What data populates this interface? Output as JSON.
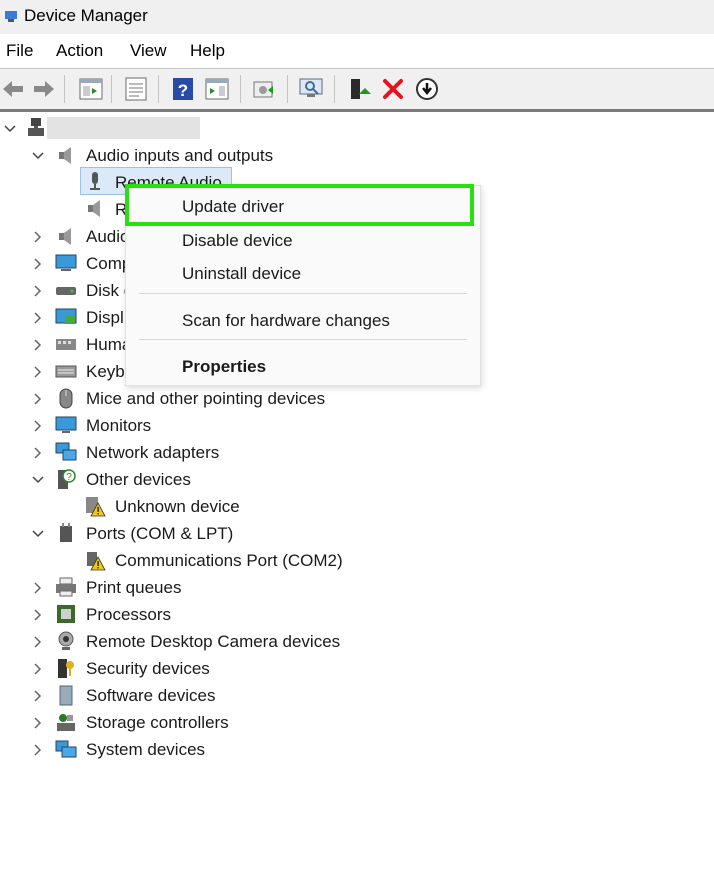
{
  "window": {
    "title": "Device Manager"
  },
  "menubar": {
    "file": "File",
    "action": "Action",
    "view": "View",
    "help": "Help"
  },
  "toolbar": {
    "icons": [
      "back-arrow-icon",
      "forward-arrow-icon",
      "show-hide-tree-icon",
      "properties-icon",
      "help-icon",
      "action-pane-icon",
      "update-driver-icon",
      "scan-hardware-icon",
      "enable-device-icon",
      "uninstall-device-icon",
      "download-driver-icon"
    ],
    "uninstall_color": "#e81123"
  },
  "tree": {
    "root_label": "",
    "categories": [
      {
        "label": "Audio inputs and outputs",
        "expanded": true,
        "icon": "speaker-icon",
        "children": [
          {
            "label": "Remote Audio",
            "icon": "microphone-icon"
          },
          {
            "label": "R",
            "icon": "speaker-icon"
          }
        ]
      },
      {
        "label": "Audio",
        "icon": "speaker-icon"
      },
      {
        "label": "Comp",
        "icon": "computer-icon"
      },
      {
        "label": "Disk d",
        "icon": "disk-drive-icon"
      },
      {
        "label": "Displ",
        "icon": "display-adapter-icon"
      },
      {
        "label": "Huma",
        "icon": "keyboard-icon"
      },
      {
        "label": "Keyb",
        "icon": "keyboard-icon"
      },
      {
        "label": "Mice and other pointing devices",
        "icon": "mouse-icon"
      },
      {
        "label": "Monitors",
        "icon": "monitor-icon"
      },
      {
        "label": "Network adapters",
        "icon": "network-icon"
      },
      {
        "label": "Other devices",
        "expanded": true,
        "icon": "unknown-device-icon",
        "children": [
          {
            "label": "Unknown device",
            "icon": "warning-device-icon"
          }
        ]
      },
      {
        "label": "Ports (COM & LPT)",
        "expanded": true,
        "icon": "port-icon",
        "children": [
          {
            "label": "Communications Port (COM2)",
            "icon": "warning-port-icon"
          }
        ]
      },
      {
        "label": "Print queues",
        "icon": "printer-icon"
      },
      {
        "label": "Processors",
        "icon": "processor-icon"
      },
      {
        "label": "Remote Desktop Camera devices",
        "icon": "camera-icon"
      },
      {
        "label": "Security devices",
        "icon": "security-icon"
      },
      {
        "label": "Software devices",
        "icon": "software-device-icon"
      },
      {
        "label": "Storage controllers",
        "icon": "storage-controller-icon"
      },
      {
        "label": "System devices",
        "icon": "system-device-icon"
      }
    ]
  },
  "context_menu": {
    "update_driver": "Update driver",
    "disable_device": "Disable device",
    "uninstall_device": "Uninstall device",
    "scan_hardware": "Scan for hardware changes",
    "properties": "Properties",
    "highlight_color": "#28e010"
  }
}
